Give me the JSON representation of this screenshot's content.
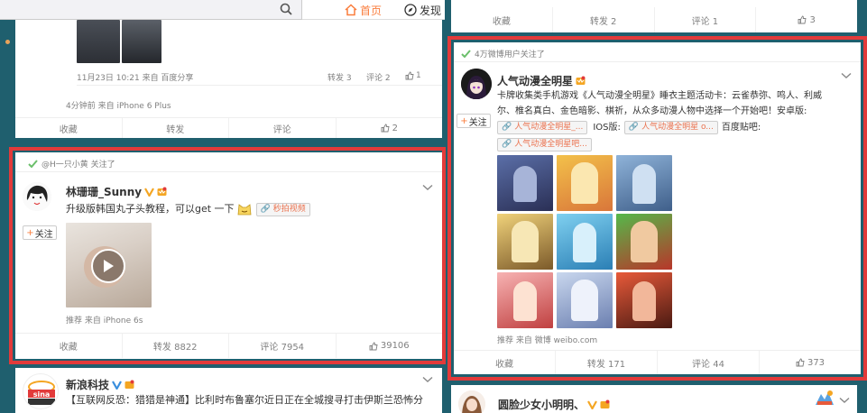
{
  "topbar": {
    "nav_home": "首页",
    "nav_discover": "发现"
  },
  "left": {
    "post1": {
      "meta": "11月23日 10:21 来自 百度分享",
      "repost": "转发 3",
      "comment": "评论 2",
      "like": "1",
      "source": "4分钟前 来自 iPhone 6 Plus",
      "actions": {
        "fav": "收藏",
        "repost": "转发",
        "comment": "评论",
        "like": "2"
      }
    },
    "post2": {
      "attention": "@H一只小黄 关注了",
      "username": "林珊珊_Sunny",
      "text": "升级版韩国丸子头教程，可以get 一下",
      "chip": "秒拍视频",
      "follow": "关注",
      "source": "推荐 来自 iPhone 6s",
      "actions": {
        "fav": "收藏",
        "repost": "转发 8822",
        "comment": "评论 7954",
        "like": "39106"
      }
    },
    "post3": {
      "username": "新浪科技",
      "text": "【互联网反恐：猎猎是神通】比利时布鲁塞尔近日正在全城搜寻打击伊斯兰恐怖分",
      "logo": "sina 新浪科技"
    }
  },
  "right": {
    "top_actions": {
      "fav": "收藏",
      "repost": "转发 2",
      "comment": "评论 1",
      "like": "3"
    },
    "post1": {
      "attention": "4万微博用户关注了",
      "username": "人气动漫全明星",
      "text1": "卡牌收集类手机游戏《人气动漫全明星》睡衣主题活动卡：云雀恭弥、鸣人、利威",
      "text2": "尔、椎名真白、金色暗影、棋祈，从众多动漫人物中选择一个开始吧！安卓版:",
      "chip1": "人气动漫全明星_...",
      "ios_label": "IOS版:",
      "chip2": "人气动漫全明星 o...",
      "baidu_label": "百度贴吧:",
      "chip3": "人气动漫全明星吧...",
      "follow": "关注",
      "source": "推荐 来自 微博 weibo.com",
      "actions": {
        "fav": "收藏",
        "repost": "转发 171",
        "comment": "评论 44",
        "like": "373"
      }
    },
    "post2": {
      "username": "圆脸少女小明明、"
    }
  },
  "colors": {
    "highlight_border": "#e23a3a",
    "accent_orange": "#fa7d3c",
    "page_bg": "#1f5f6e"
  }
}
